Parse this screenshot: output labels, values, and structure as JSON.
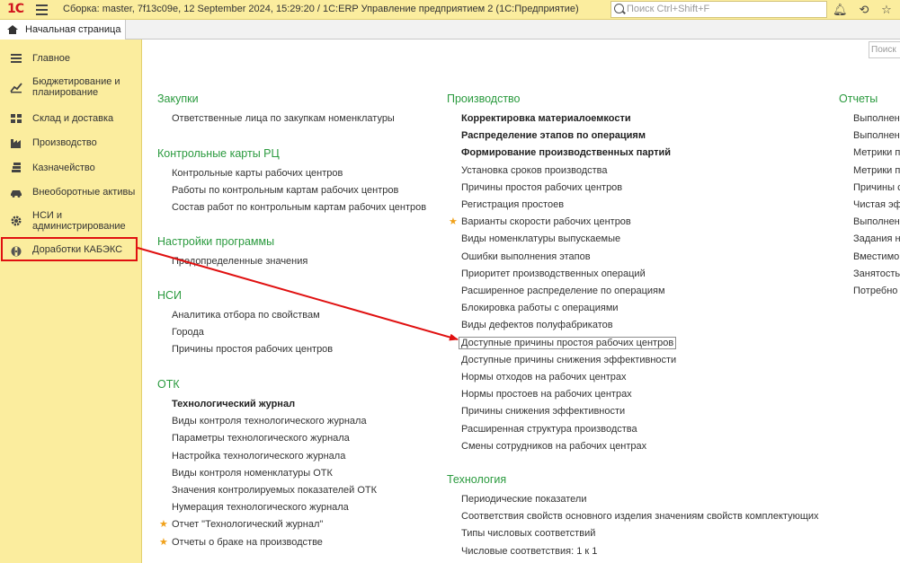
{
  "window": {
    "logo": "1С",
    "title": "Сборка: master, 7f13c09e, 12 September 2024, 15:29:20 / 1С:ERP Управление предприятием 2  (1С:Предприятие)",
    "search_placeholder": "Поиск Ctrl+Shift+F"
  },
  "tab": {
    "label": "Начальная страница"
  },
  "sidebar": {
    "items": [
      {
        "label": "Главное",
        "icon": "menu-lines-icon"
      },
      {
        "label": "Бюджетирование и планирование",
        "icon": "chart-icon"
      },
      {
        "label": "Склад и доставка",
        "icon": "warehouse-icon"
      },
      {
        "label": "Производство",
        "icon": "factory-icon"
      },
      {
        "label": "Казначейство",
        "icon": "coins-icon"
      },
      {
        "label": "Внеоборотные активы",
        "icon": "car-icon"
      },
      {
        "label": "НСИ и администрирование",
        "icon": "gear-icon"
      },
      {
        "label": "Доработки КАБЭКС",
        "icon": "kabeks-icon"
      }
    ]
  },
  "main": {
    "search_placeholder": "Поиск",
    "col1": [
      {
        "title": "Закупки",
        "links": [
          "Ответственные лица по закупкам номенклатуры"
        ]
      },
      {
        "title": "Контрольные карты РЦ",
        "links": [
          "Контрольные карты рабочих центров",
          "Работы по контрольным картам рабочих центров",
          "Состав работ по контрольным картам рабочих центров"
        ]
      },
      {
        "title": "Настройки программы",
        "links": [
          "Предопределенные значения"
        ]
      },
      {
        "title": "НСИ",
        "links": [
          "Аналитика отбора по свойствам",
          "Города",
          "Причины простоя рабочих центров"
        ]
      },
      {
        "title": "ОТК",
        "links": [
          "Технологический журнал",
          "Виды контроля технологического журнала",
          "Параметры технологического журнала",
          "Настройка технологического журнала",
          "Виды контроля номенклатуры ОТК",
          "Значения контролируемых показателей ОТК",
          "Нумерация технологического журнала",
          "Отчет \"Технологический журнал\"",
          "Отчеты о браке на производстве"
        ]
      }
    ],
    "col2": [
      {
        "title": "Производство",
        "links": [
          "Корректировка материалоемкости",
          "Распределение этапов по операциям",
          "Формирование производственных партий",
          "Установка сроков производства",
          "Причины простоя рабочих центров",
          "Регистрация простоев",
          "Варианты скорости рабочих центров",
          "Виды номенклатуры выпускаемые",
          "Ошибки выполнения этапов",
          "Приоритет производственных операций",
          "Расширенное распределение по операциям",
          "Блокировка работы с операциями",
          "Виды дефектов полуфабрикатов",
          "Доступные причины простоя рабочих центров",
          "Доступные причины снижения эффективности",
          "Нормы отходов на рабочих центрах",
          "Нормы простоев на рабочих центрах",
          "Причины снижения эффективности",
          "Расширенная структура производства",
          "Смены сотрудников на рабочих центрах"
        ]
      },
      {
        "title": "Технология",
        "links": [
          "Периодические показатели",
          "Соответствия свойств основного изделия значениям свойств комплектующих",
          "Типы числовых соответствий",
          "Числовые соответствия: 1 к 1"
        ]
      }
    ],
    "col3": [
      {
        "title": "Отчеты",
        "links": [
          "Выполнен",
          "Выполнен",
          "Метрики п",
          "Метрики п",
          "Причины с",
          "Чистая эф",
          "Выполнен",
          "Задания н",
          "Вместимо",
          "Занятость",
          "Потребно"
        ]
      }
    ]
  },
  "colors": {
    "accent_yellow": "#fbed9e",
    "group_green": "#2a9a3e",
    "callout_red": "#e01010",
    "star_orange": "#f0a11a"
  }
}
